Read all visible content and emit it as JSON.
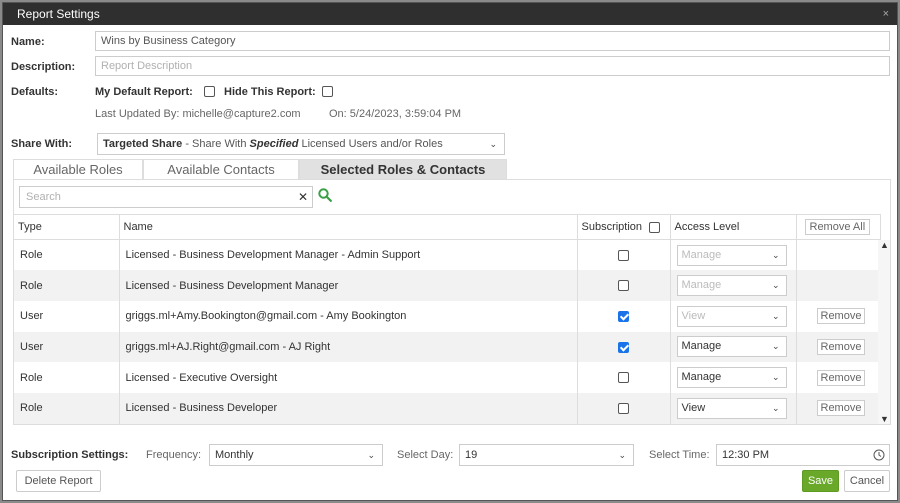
{
  "window": {
    "title": "Report Settings",
    "close_glyph": "×"
  },
  "form": {
    "name_label": "Name:",
    "name_value": "Wins by Business Category",
    "description_label": "Description:",
    "description_placeholder": "Report Description",
    "defaults_label": "Defaults:",
    "my_default_label": "My Default Report:",
    "hide_label": "Hide This Report:",
    "last_updated_text": "Last Updated By: michelle@capture2.com",
    "on_text": "On: 5/24/2023, 3:59:04 PM",
    "share_label": "Share With:",
    "share_value_bold": "Targeted Share",
    "share_value_mid": " - Share With ",
    "share_value_em": "Specified",
    "share_value_rest": " Licensed Users and/or Roles"
  },
  "tabs": [
    {
      "label": "Available Roles",
      "active": false
    },
    {
      "label": "Available Contacts",
      "active": false
    },
    {
      "label": "Selected Roles & Contacts",
      "active": true
    }
  ],
  "search": {
    "placeholder": "Search",
    "clear_glyph": "✕"
  },
  "table": {
    "headers": {
      "type": "Type",
      "name": "Name",
      "subscription": "Subscription",
      "access": "Access Level",
      "remove_all": "Remove All"
    },
    "rows": [
      {
        "type": "Role",
        "name": "Licensed - Business Development Manager - Admin Support",
        "subscribed": false,
        "access": "Manage",
        "enabled": false,
        "remove": ""
      },
      {
        "type": "Role",
        "name": "Licensed - Business Development Manager",
        "subscribed": false,
        "access": "Manage",
        "enabled": false,
        "remove": ""
      },
      {
        "type": "User",
        "name": "griggs.ml+Amy.Bookington@gmail.com - Amy Bookington",
        "subscribed": true,
        "access": "View",
        "enabled": false,
        "remove": "Remove"
      },
      {
        "type": "User",
        "name": "griggs.ml+AJ.Right@gmail.com - AJ Right",
        "subscribed": true,
        "access": "Manage",
        "enabled": true,
        "remove": "Remove"
      },
      {
        "type": "Role",
        "name": "Licensed - Executive Oversight",
        "subscribed": false,
        "access": "Manage",
        "enabled": true,
        "remove": "Remove"
      },
      {
        "type": "Role",
        "name": "Licensed - Business Developer",
        "subscribed": false,
        "access": "View",
        "enabled": true,
        "remove": "Remove"
      }
    ]
  },
  "subscription": {
    "label": "Subscription Settings:",
    "frequency_label": "Frequency:",
    "frequency_value": "Monthly",
    "day_label": "Select Day:",
    "day_value": "19",
    "time_label": "Select Time:",
    "time_value": "12:30 PM"
  },
  "buttons": {
    "delete": "Delete Report",
    "save": "Save",
    "cancel": "Cancel"
  },
  "colors": {
    "titlebar": "#2f2f2f",
    "save": "#6aa82a",
    "checked": "#1a73e8",
    "search_icon": "#3aa047"
  }
}
